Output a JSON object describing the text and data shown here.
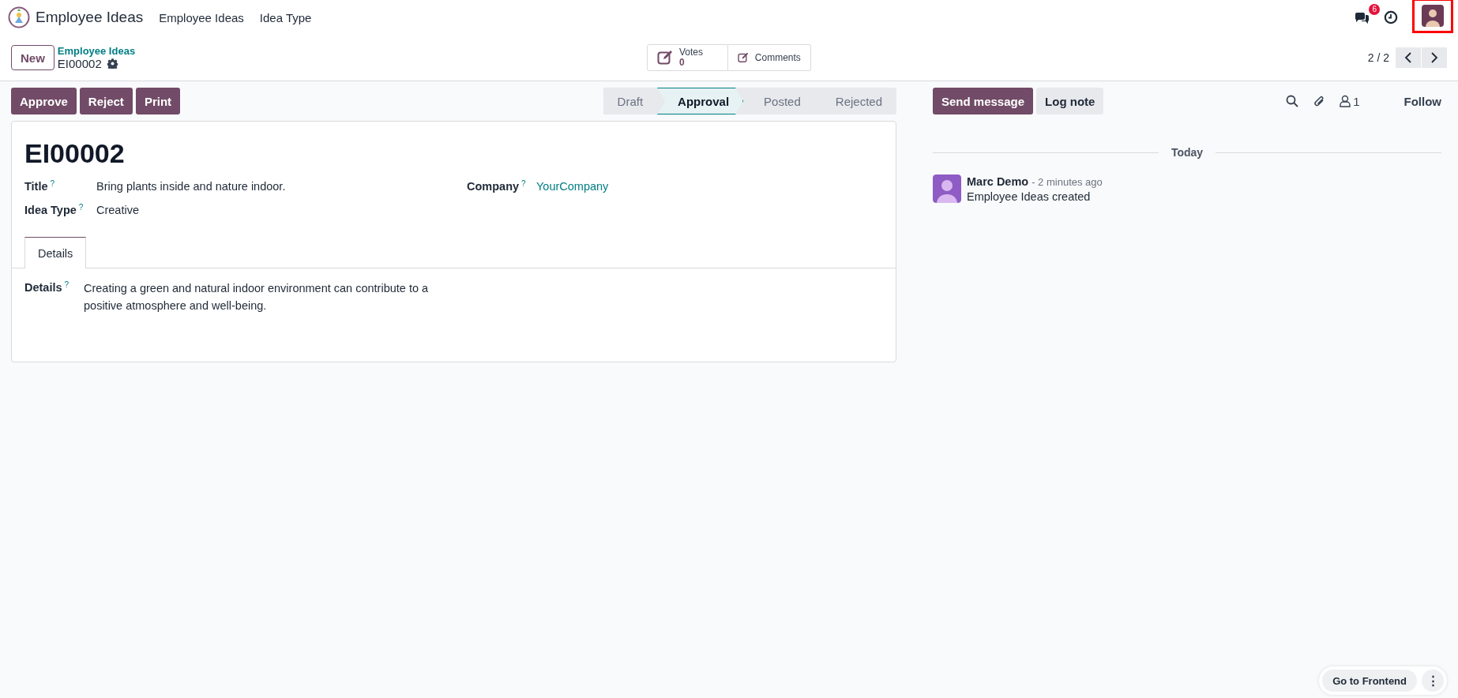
{
  "top_bar": {
    "app_name": "Employee Ideas",
    "menu": [
      {
        "label": "Employee Ideas"
      },
      {
        "label": "Idea Type"
      }
    ],
    "messages_badge": "6"
  },
  "control_panel": {
    "new_button": "New",
    "breadcrumb": {
      "parent": "Employee Ideas",
      "current": "EI00002"
    },
    "smart_buttons": [
      {
        "label": "Votes",
        "value": "0"
      },
      {
        "label": "Comments"
      }
    ],
    "pager": "2 / 2"
  },
  "actions": [
    "Approve",
    "Reject",
    "Print"
  ],
  "stages": [
    {
      "label": "Draft",
      "selected": false
    },
    {
      "label": "Approval",
      "selected": true
    },
    {
      "label": "Posted",
      "selected": false
    },
    {
      "label": "Rejected",
      "selected": false
    }
  ],
  "form": {
    "reference": "EI00002",
    "fields_left": [
      {
        "label": "Title",
        "help": "?",
        "value": "Bring plants inside and nature indoor."
      },
      {
        "label": "Idea Type",
        "help": "?",
        "value": "Creative"
      }
    ],
    "fields_right": [
      {
        "label": "Company",
        "help": "?",
        "value": "YourCompany"
      }
    ],
    "tabs": [
      {
        "label": "Details",
        "selected": true
      }
    ],
    "details": {
      "label": "Details",
      "help": "?",
      "value": "Creating a green and natural indoor environment can contribute to a positive atmosphere and well-being."
    }
  },
  "chatter": {
    "buttons": [
      {
        "label": "Send message",
        "kind": "primary"
      },
      {
        "label": "Log note",
        "kind": "secondary"
      }
    ],
    "followers": "1",
    "follow": "Follow",
    "date": "Today",
    "messages": [
      {
        "author": "Marc Demo",
        "time": "- 2 minutes ago",
        "body": "Employee Ideas created"
      }
    ]
  },
  "footer": {
    "go_to_frontend": "Go to Frontend",
    "more": "⋮"
  }
}
